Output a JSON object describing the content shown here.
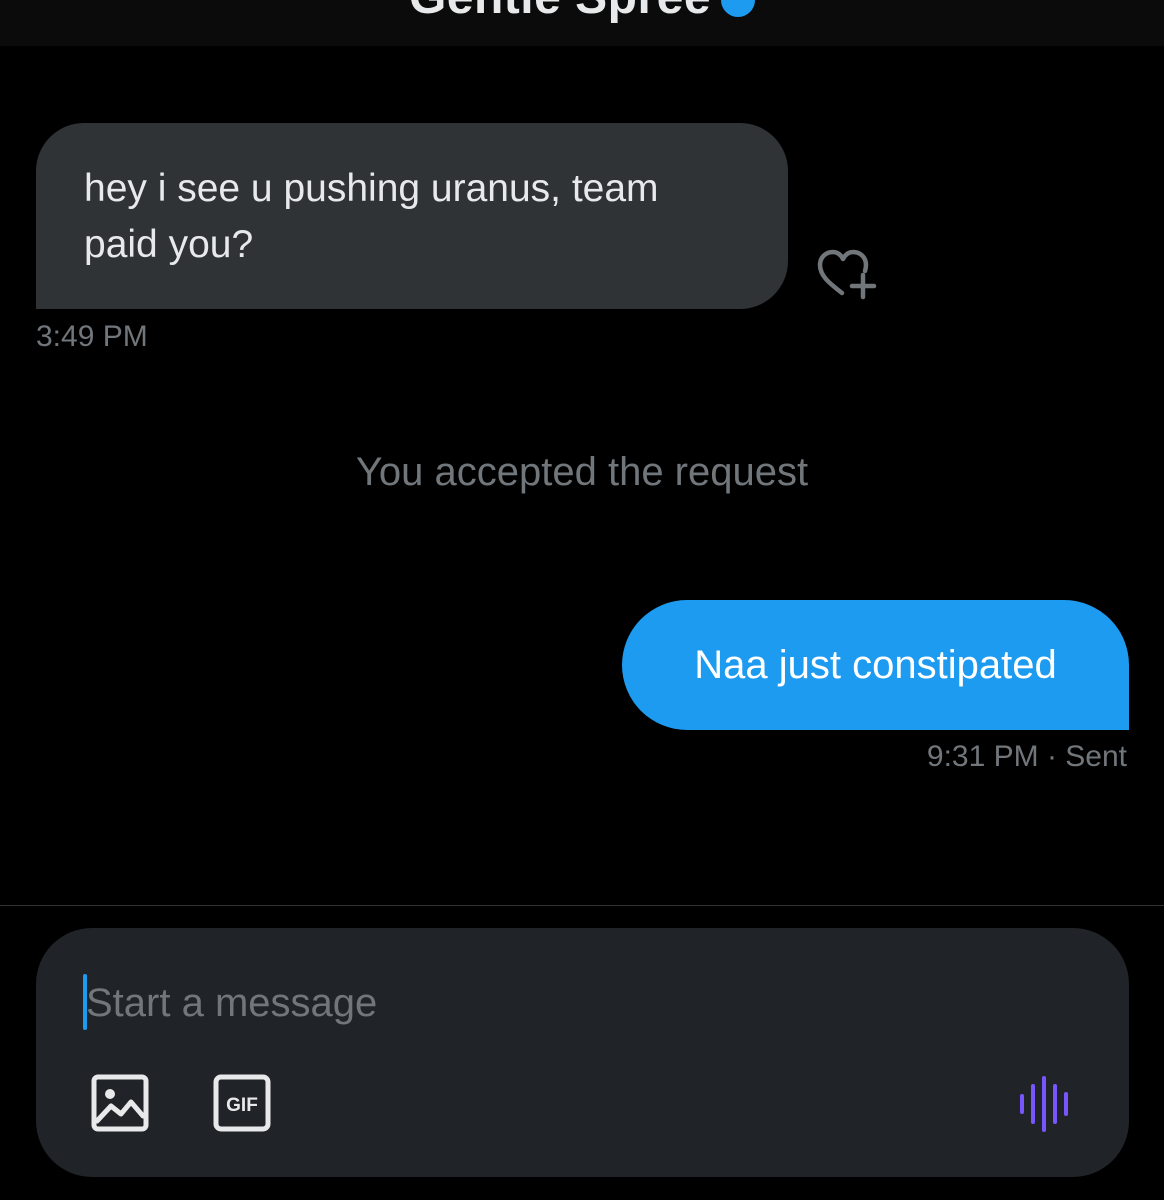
{
  "header": {
    "title": "Gentle Spree"
  },
  "messages": {
    "incoming": {
      "text": "hey i see u pushing uranus, team paid you?",
      "time": "3:49 PM"
    },
    "system": "You accepted the request",
    "outgoing": {
      "text": "Naa just constipated",
      "status": "9:31 PM · Sent"
    }
  },
  "composer": {
    "placeholder": "Start a message",
    "gif_label": "GIF"
  },
  "icons": {
    "react": "heart-plus-icon",
    "media": "image-icon",
    "gif": "gif-icon",
    "voice": "voice-wave-icon"
  },
  "colors": {
    "background": "#000000",
    "accent": "#1d9bf0",
    "incoming_bubble": "#2f3336",
    "muted_text": "#71767b",
    "voice_icon": "#7856ff"
  }
}
